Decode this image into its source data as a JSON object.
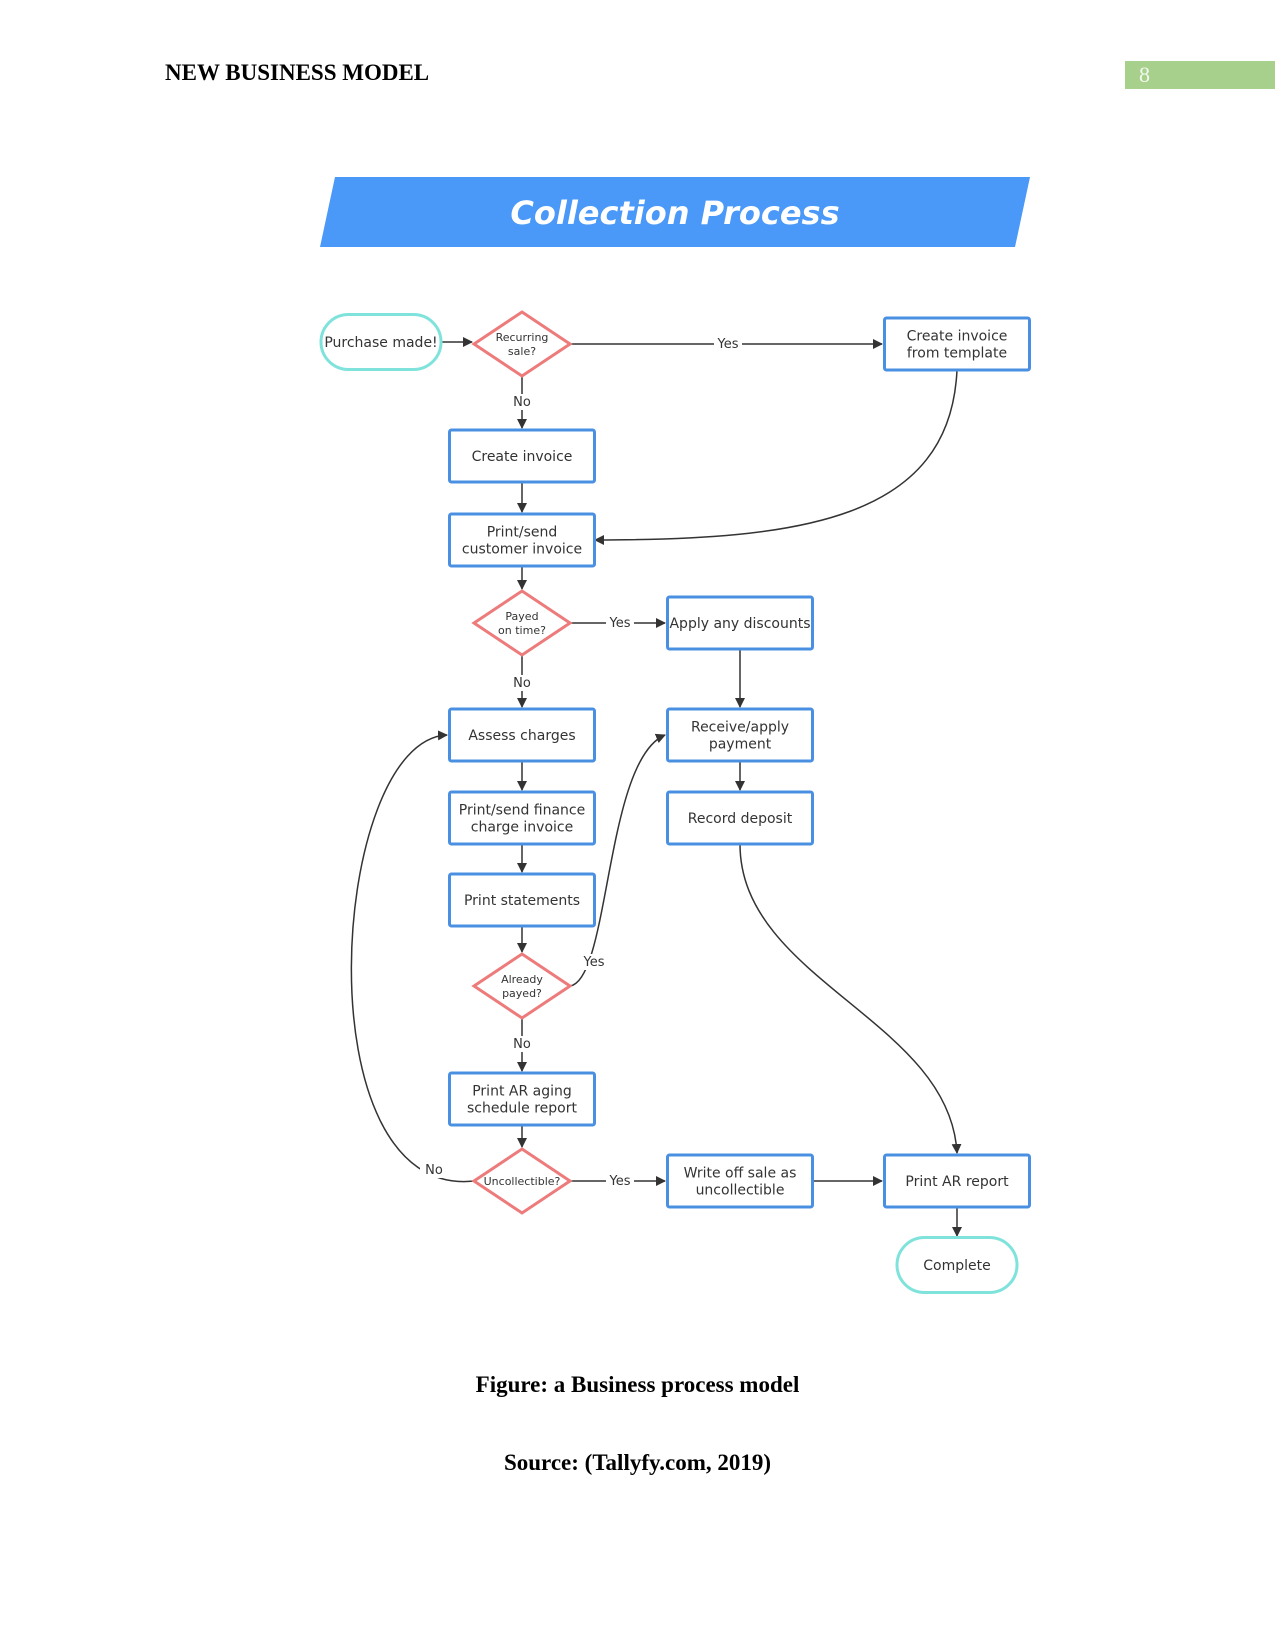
{
  "header": {
    "title": "NEW BUSINESS MODEL",
    "page_number": "8"
  },
  "diagram": {
    "title": "Collection Process",
    "colors": {
      "banner": "#4a98f7",
      "process_border": "#4a90e2",
      "decision_border": "#ee7b7b",
      "terminal_border": "#7fe3dc",
      "edge": "#333333",
      "page_number_bar": "#a8d08d"
    },
    "nodes": [
      {
        "id": "purchase",
        "type": "terminal",
        "label": [
          "Purchase made!"
        ]
      },
      {
        "id": "recurring",
        "type": "decision",
        "label": [
          "Recurring",
          "sale?"
        ]
      },
      {
        "id": "template",
        "type": "process",
        "label": [
          "Create invoice",
          "from template"
        ]
      },
      {
        "id": "create",
        "type": "process",
        "label": [
          "Create invoice"
        ]
      },
      {
        "id": "printsend",
        "type": "process",
        "label": [
          "Print/send",
          "customer invoice"
        ]
      },
      {
        "id": "ontime",
        "type": "decision",
        "label": [
          "Payed",
          "on time?"
        ]
      },
      {
        "id": "discounts",
        "type": "process",
        "label": [
          "Apply any discounts"
        ]
      },
      {
        "id": "assess",
        "type": "process",
        "label": [
          "Assess charges"
        ]
      },
      {
        "id": "receive",
        "type": "process",
        "label": [
          "Receive/apply",
          "payment"
        ]
      },
      {
        "id": "finance",
        "type": "process",
        "label": [
          "Print/send finance",
          "charge invoice"
        ]
      },
      {
        "id": "deposit",
        "type": "process",
        "label": [
          "Record deposit"
        ]
      },
      {
        "id": "statements",
        "type": "process",
        "label": [
          "Print statements"
        ]
      },
      {
        "id": "already",
        "type": "decision",
        "label": [
          "Already",
          "payed?"
        ]
      },
      {
        "id": "aging",
        "type": "process",
        "label": [
          "Print AR aging",
          "schedule report"
        ]
      },
      {
        "id": "uncollectible",
        "type": "decision",
        "label": [
          "Uncollectible?"
        ]
      },
      {
        "id": "writeoff",
        "type": "process",
        "label": [
          "Write off sale as",
          "uncollectible"
        ]
      },
      {
        "id": "arreport",
        "type": "process",
        "label": [
          "Print AR report"
        ]
      },
      {
        "id": "complete",
        "type": "terminal",
        "label": [
          "Complete"
        ]
      }
    ],
    "edges": [
      {
        "from": "purchase",
        "to": "recurring",
        "label": ""
      },
      {
        "from": "recurring",
        "to": "template",
        "label": "Yes"
      },
      {
        "from": "recurring",
        "to": "create",
        "label": "No"
      },
      {
        "from": "template",
        "to": "printsend",
        "label": ""
      },
      {
        "from": "create",
        "to": "printsend",
        "label": ""
      },
      {
        "from": "printsend",
        "to": "ontime",
        "label": ""
      },
      {
        "from": "ontime",
        "to": "discounts",
        "label": "Yes"
      },
      {
        "from": "ontime",
        "to": "assess",
        "label": "No"
      },
      {
        "from": "discounts",
        "to": "receive",
        "label": ""
      },
      {
        "from": "receive",
        "to": "deposit",
        "label": ""
      },
      {
        "from": "assess",
        "to": "finance",
        "label": ""
      },
      {
        "from": "finance",
        "to": "statements",
        "label": ""
      },
      {
        "from": "statements",
        "to": "already",
        "label": ""
      },
      {
        "from": "already",
        "to": "receive",
        "label": "Yes"
      },
      {
        "from": "already",
        "to": "aging",
        "label": "No"
      },
      {
        "from": "aging",
        "to": "uncollectible",
        "label": ""
      },
      {
        "from": "uncollectible",
        "to": "assess",
        "label": "No"
      },
      {
        "from": "uncollectible",
        "to": "writeoff",
        "label": "Yes"
      },
      {
        "from": "writeoff",
        "to": "arreport",
        "label": ""
      },
      {
        "from": "deposit",
        "to": "arreport",
        "label": ""
      },
      {
        "from": "arreport",
        "to": "complete",
        "label": ""
      }
    ]
  },
  "captions": {
    "figure": "Figure: a Business process model",
    "source": "Source: (Tallyfy.com, 2019)"
  }
}
